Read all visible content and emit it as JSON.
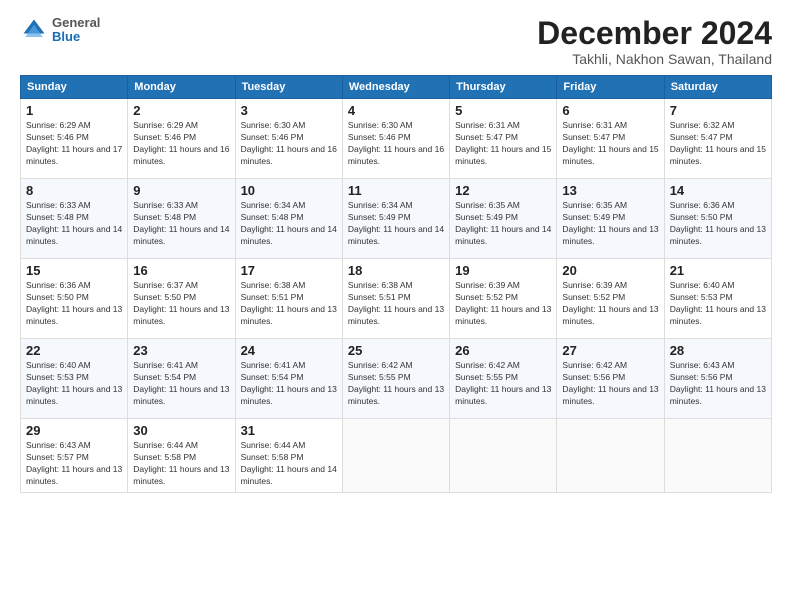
{
  "header": {
    "logo_general": "General",
    "logo_blue": "Blue",
    "month_title": "December 2024",
    "location": "Takhli, Nakhon Sawan, Thailand"
  },
  "weekdays": [
    "Sunday",
    "Monday",
    "Tuesday",
    "Wednesday",
    "Thursday",
    "Friday",
    "Saturday"
  ],
  "weeks": [
    [
      {
        "day": "1",
        "info": "Sunrise: 6:29 AM\nSunset: 5:46 PM\nDaylight: 11 hours and 17 minutes."
      },
      {
        "day": "2",
        "info": "Sunrise: 6:29 AM\nSunset: 5:46 PM\nDaylight: 11 hours and 16 minutes."
      },
      {
        "day": "3",
        "info": "Sunrise: 6:30 AM\nSunset: 5:46 PM\nDaylight: 11 hours and 16 minutes."
      },
      {
        "day": "4",
        "info": "Sunrise: 6:30 AM\nSunset: 5:46 PM\nDaylight: 11 hours and 16 minutes."
      },
      {
        "day": "5",
        "info": "Sunrise: 6:31 AM\nSunset: 5:47 PM\nDaylight: 11 hours and 15 minutes."
      },
      {
        "day": "6",
        "info": "Sunrise: 6:31 AM\nSunset: 5:47 PM\nDaylight: 11 hours and 15 minutes."
      },
      {
        "day": "7",
        "info": "Sunrise: 6:32 AM\nSunset: 5:47 PM\nDaylight: 11 hours and 15 minutes."
      }
    ],
    [
      {
        "day": "8",
        "info": "Sunrise: 6:33 AM\nSunset: 5:48 PM\nDaylight: 11 hours and 14 minutes."
      },
      {
        "day": "9",
        "info": "Sunrise: 6:33 AM\nSunset: 5:48 PM\nDaylight: 11 hours and 14 minutes."
      },
      {
        "day": "10",
        "info": "Sunrise: 6:34 AM\nSunset: 5:48 PM\nDaylight: 11 hours and 14 minutes."
      },
      {
        "day": "11",
        "info": "Sunrise: 6:34 AM\nSunset: 5:49 PM\nDaylight: 11 hours and 14 minutes."
      },
      {
        "day": "12",
        "info": "Sunrise: 6:35 AM\nSunset: 5:49 PM\nDaylight: 11 hours and 14 minutes."
      },
      {
        "day": "13",
        "info": "Sunrise: 6:35 AM\nSunset: 5:49 PM\nDaylight: 11 hours and 13 minutes."
      },
      {
        "day": "14",
        "info": "Sunrise: 6:36 AM\nSunset: 5:50 PM\nDaylight: 11 hours and 13 minutes."
      }
    ],
    [
      {
        "day": "15",
        "info": "Sunrise: 6:36 AM\nSunset: 5:50 PM\nDaylight: 11 hours and 13 minutes."
      },
      {
        "day": "16",
        "info": "Sunrise: 6:37 AM\nSunset: 5:50 PM\nDaylight: 11 hours and 13 minutes."
      },
      {
        "day": "17",
        "info": "Sunrise: 6:38 AM\nSunset: 5:51 PM\nDaylight: 11 hours and 13 minutes."
      },
      {
        "day": "18",
        "info": "Sunrise: 6:38 AM\nSunset: 5:51 PM\nDaylight: 11 hours and 13 minutes."
      },
      {
        "day": "19",
        "info": "Sunrise: 6:39 AM\nSunset: 5:52 PM\nDaylight: 11 hours and 13 minutes."
      },
      {
        "day": "20",
        "info": "Sunrise: 6:39 AM\nSunset: 5:52 PM\nDaylight: 11 hours and 13 minutes."
      },
      {
        "day": "21",
        "info": "Sunrise: 6:40 AM\nSunset: 5:53 PM\nDaylight: 11 hours and 13 minutes."
      }
    ],
    [
      {
        "day": "22",
        "info": "Sunrise: 6:40 AM\nSunset: 5:53 PM\nDaylight: 11 hours and 13 minutes."
      },
      {
        "day": "23",
        "info": "Sunrise: 6:41 AM\nSunset: 5:54 PM\nDaylight: 11 hours and 13 minutes."
      },
      {
        "day": "24",
        "info": "Sunrise: 6:41 AM\nSunset: 5:54 PM\nDaylight: 11 hours and 13 minutes."
      },
      {
        "day": "25",
        "info": "Sunrise: 6:42 AM\nSunset: 5:55 PM\nDaylight: 11 hours and 13 minutes."
      },
      {
        "day": "26",
        "info": "Sunrise: 6:42 AM\nSunset: 5:55 PM\nDaylight: 11 hours and 13 minutes."
      },
      {
        "day": "27",
        "info": "Sunrise: 6:42 AM\nSunset: 5:56 PM\nDaylight: 11 hours and 13 minutes."
      },
      {
        "day": "28",
        "info": "Sunrise: 6:43 AM\nSunset: 5:56 PM\nDaylight: 11 hours and 13 minutes."
      }
    ],
    [
      {
        "day": "29",
        "info": "Sunrise: 6:43 AM\nSunset: 5:57 PM\nDaylight: 11 hours and 13 minutes."
      },
      {
        "day": "30",
        "info": "Sunrise: 6:44 AM\nSunset: 5:58 PM\nDaylight: 11 hours and 13 minutes."
      },
      {
        "day": "31",
        "info": "Sunrise: 6:44 AM\nSunset: 5:58 PM\nDaylight: 11 hours and 14 minutes."
      },
      {
        "day": "",
        "info": ""
      },
      {
        "day": "",
        "info": ""
      },
      {
        "day": "",
        "info": ""
      },
      {
        "day": "",
        "info": ""
      }
    ]
  ]
}
